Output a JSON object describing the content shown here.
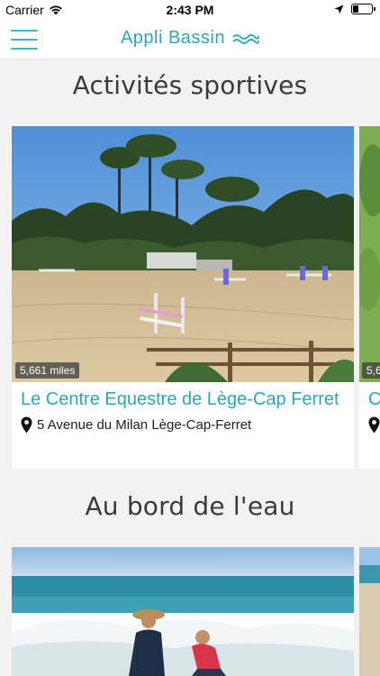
{
  "status_bar": {
    "carrier": "Carrier",
    "time": "2:43 PM"
  },
  "header": {
    "title": "Appli Bassin",
    "accent_color": "#2aa6bf"
  },
  "sections": [
    {
      "title": "Activités sportives",
      "cards": [
        {
          "distance": "5,661 miles",
          "name": "Le Centre Equestre de Lège-Cap Ferret",
          "address": "5 Avenue du Milan Lège-Cap-Ferret"
        },
        {
          "distance": "5,6",
          "name": "C",
          "address": ""
        }
      ]
    },
    {
      "title": "Au bord de l'eau",
      "cards": [
        {
          "distance": "",
          "name": "",
          "address": ""
        }
      ]
    }
  ]
}
